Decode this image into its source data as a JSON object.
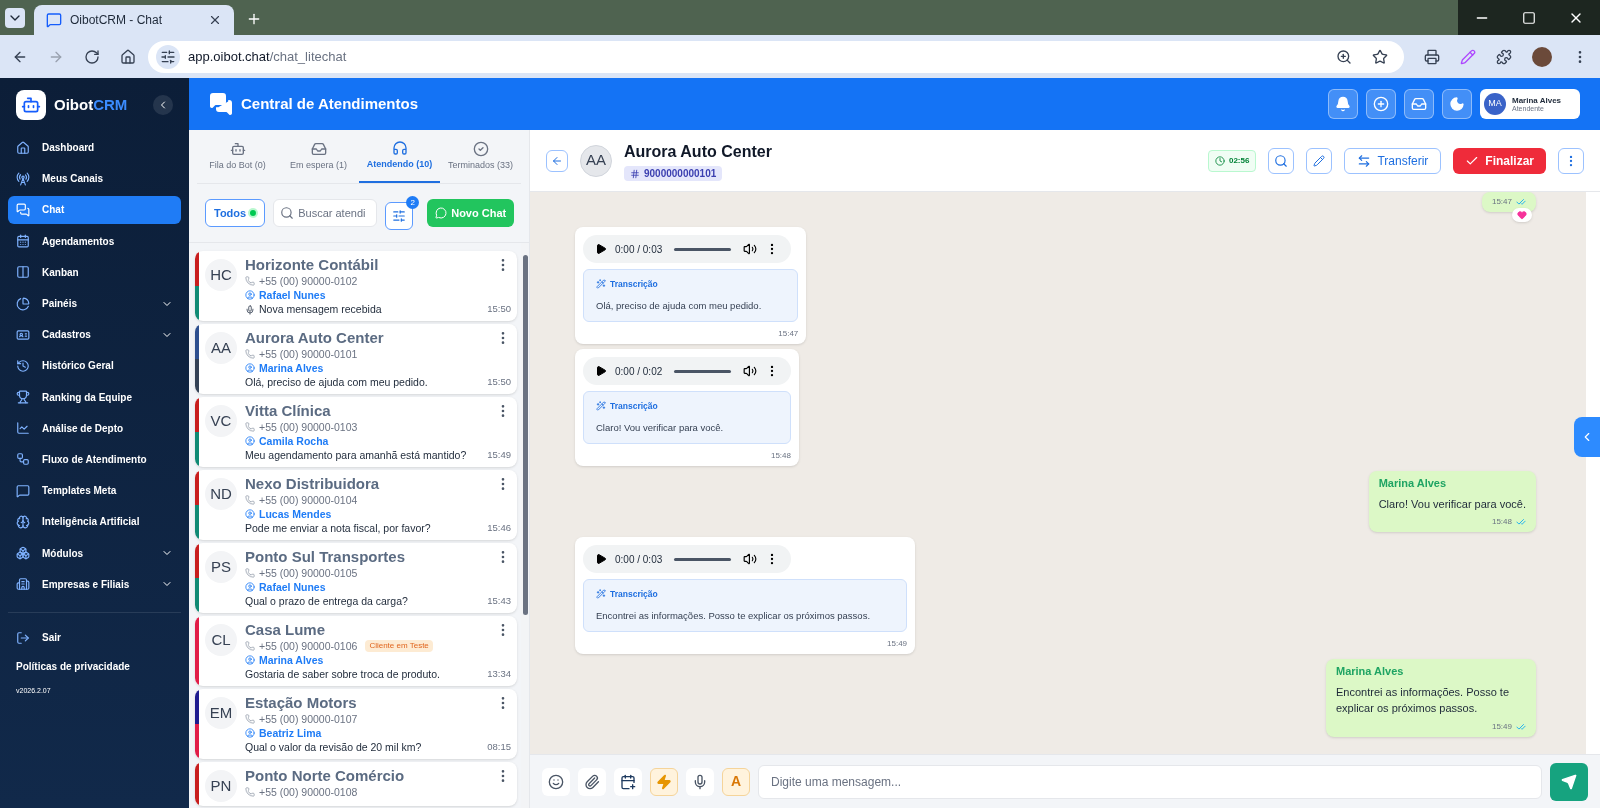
{
  "browser": {
    "tab_title": "OibotCRM - Chat",
    "url_host": "app.oibot.chat",
    "url_path": "/chat_litechat"
  },
  "sidebar": {
    "brand_prefix": "Oibot",
    "brand_suffix": "CRM",
    "items": [
      {
        "label": "Dashboard",
        "selected": false,
        "expandable": false
      },
      {
        "label": "Meus Canais",
        "selected": false,
        "expandable": false
      },
      {
        "label": "Chat",
        "selected": true,
        "expandable": false
      },
      {
        "label": "Agendamentos",
        "selected": false,
        "expandable": false
      },
      {
        "label": "Kanban",
        "selected": false,
        "expandable": false
      },
      {
        "label": "Painéis",
        "selected": false,
        "expandable": true
      },
      {
        "label": "Cadastros",
        "selected": false,
        "expandable": true
      },
      {
        "label": "Histórico Geral",
        "selected": false,
        "expandable": false
      },
      {
        "label": "Ranking da Equipe",
        "selected": false,
        "expandable": false
      },
      {
        "label": "Análise de Depto",
        "selected": false,
        "expandable": false
      },
      {
        "label": "Fluxo de Atendimento",
        "selected": false,
        "expandable": false
      },
      {
        "label": "Templates Meta",
        "selected": false,
        "expandable": false
      },
      {
        "label": "Inteligência Artificial",
        "selected": false,
        "expandable": false
      },
      {
        "label": "Módulos",
        "selected": false,
        "expandable": true
      },
      {
        "label": "Empresas e Filiais",
        "selected": false,
        "expandable": true
      }
    ],
    "logout": "Sair",
    "privacy": "Políticas de privacidade",
    "version": "v2026.2.07"
  },
  "header": {
    "title": "Central de Atendimentos",
    "user_initials": "MA",
    "user_name": "Marina Alves",
    "user_role": "Atendente"
  },
  "queue_tabs": [
    {
      "label": "Fila do Bot (0)",
      "selected": false
    },
    {
      "label": "Em espera (1)",
      "selected": false
    },
    {
      "label": "Atendendo (10)",
      "selected": true
    },
    {
      "label": "Terminados (33)",
      "selected": false
    }
  ],
  "filters": {
    "all_label": "Todos",
    "search_placeholder": "Buscar atendi",
    "filter_count": "2",
    "new_chat": "Novo Chat"
  },
  "conversations": [
    {
      "initials": "HC",
      "name": "Horizonte Contábil",
      "phone": "+55 (00) 90000-0102",
      "agent": "Rafael Nunes",
      "preview": "Nova mensagem recebida",
      "voice_note": true,
      "time": "15:50",
      "stripes": [
        {
          "color": "#c81e1e"
        },
        {
          "color": "#0f8a74"
        }
      ]
    },
    {
      "initials": "AA",
      "name": "Aurora Auto Center",
      "phone": "+55 (00) 90000-0101",
      "agent": "Marina Alves",
      "preview": "Olá, preciso de ajuda com meu pedido.",
      "voice_note": false,
      "time": "15:50",
      "stripes": [
        {
          "color": "#2d4f8f"
        },
        {
          "color": "#334155"
        }
      ]
    },
    {
      "initials": "VC",
      "name": "Vitta Clínica",
      "phone": "+55 (00) 90000-0103",
      "agent": "Camila Rocha",
      "preview": "Meu agendamento para amanhã está mantido?",
      "voice_note": false,
      "time": "15:49",
      "stripes": [
        {
          "color": "#c81e1e"
        },
        {
          "color": "#0f8a74"
        }
      ]
    },
    {
      "initials": "ND",
      "name": "Nexo Distribuidora",
      "phone": "+55 (00) 90000-0104",
      "agent": "Lucas Mendes",
      "preview": "Pode me enviar a nota fiscal, por favor?",
      "voice_note": false,
      "time": "15:46",
      "stripes": [
        {
          "color": "#c81e1e"
        },
        {
          "color": "#0f8a74"
        }
      ]
    },
    {
      "initials": "PS",
      "name": "Ponto Sul Transportes",
      "phone": "+55 (00) 90000-0105",
      "agent": "Rafael Nunes",
      "preview": "Qual o prazo de entrega da carga?",
      "voice_note": false,
      "time": "15:43",
      "stripes": [
        {
          "color": "#c81e1e"
        },
        {
          "color": "#0f8a74"
        }
      ]
    },
    {
      "initials": "CL",
      "name": "Casa Lume",
      "phone": "+55 (00) 90000-0106",
      "tag": "Cliente em Teste",
      "agent": "Marina Alves",
      "preview": "Gostaria de saber sobre troca de produto.",
      "voice_note": false,
      "time": "13:34",
      "stripes": [
        {
          "color": "#e11d48"
        },
        {
          "color": "#e11d48"
        }
      ]
    },
    {
      "initials": "EM",
      "name": "Estação Motors",
      "phone": "+55 (00) 90000-0107",
      "agent": "Beatriz Lima",
      "preview": "Qual o valor da revisão de 20 mil km?",
      "voice_note": false,
      "time": "08:15",
      "stripes": [
        {
          "color": "#1e1b8f"
        },
        {
          "color": "#e11d48"
        }
      ]
    },
    {
      "initials": "PN",
      "name": "Ponto Norte Comércio",
      "phone": "+55 (00) 90000-0108",
      "stripes": [
        {
          "color": "#c81e1e"
        },
        {
          "color": "#c81e1e"
        }
      ]
    }
  ],
  "chat": {
    "initials": "AA",
    "name": "Aurora Auto Center",
    "ticket": "9000000000101",
    "timer": "02:56",
    "transfer": "Transferir",
    "finish": "Finalizar"
  },
  "messages": [
    {
      "kind": "text",
      "time": "15:47",
      "read": true,
      "reacted": true
    },
    {
      "kind": "audio",
      "duration": "0:00 / 0:03",
      "transcription_label": "Transcrição",
      "transcription": "Olá, preciso de ajuda com meu pedido.",
      "time": "15:47"
    },
    {
      "kind": "audio",
      "duration": "0:00 / 0:02",
      "transcription_label": "Transcrição",
      "transcription": "Claro! Vou verificar para você.",
      "time": "15:48"
    },
    {
      "kind": "text",
      "sender": "Marina Alves",
      "text": "Claro! Vou verificar para você.",
      "time": "15:48",
      "read": true,
      "reacted": false
    },
    {
      "kind": "audio",
      "duration": "0:00 / 0:03",
      "transcription_label": "Transcrição",
      "transcription": "Encontrei as informações. Posso te explicar os próximos passos.",
      "time": "15:49"
    },
    {
      "kind": "text",
      "sender": "Marina Alves",
      "text": "Encontrei as informações. Posso te explicar os próximos passos.",
      "time": "15:49",
      "read": true,
      "reacted": false
    }
  ],
  "composer": {
    "placeholder": "Digite uma mensagem...",
    "font_button": "A",
    "quick_replies_on": true
  }
}
